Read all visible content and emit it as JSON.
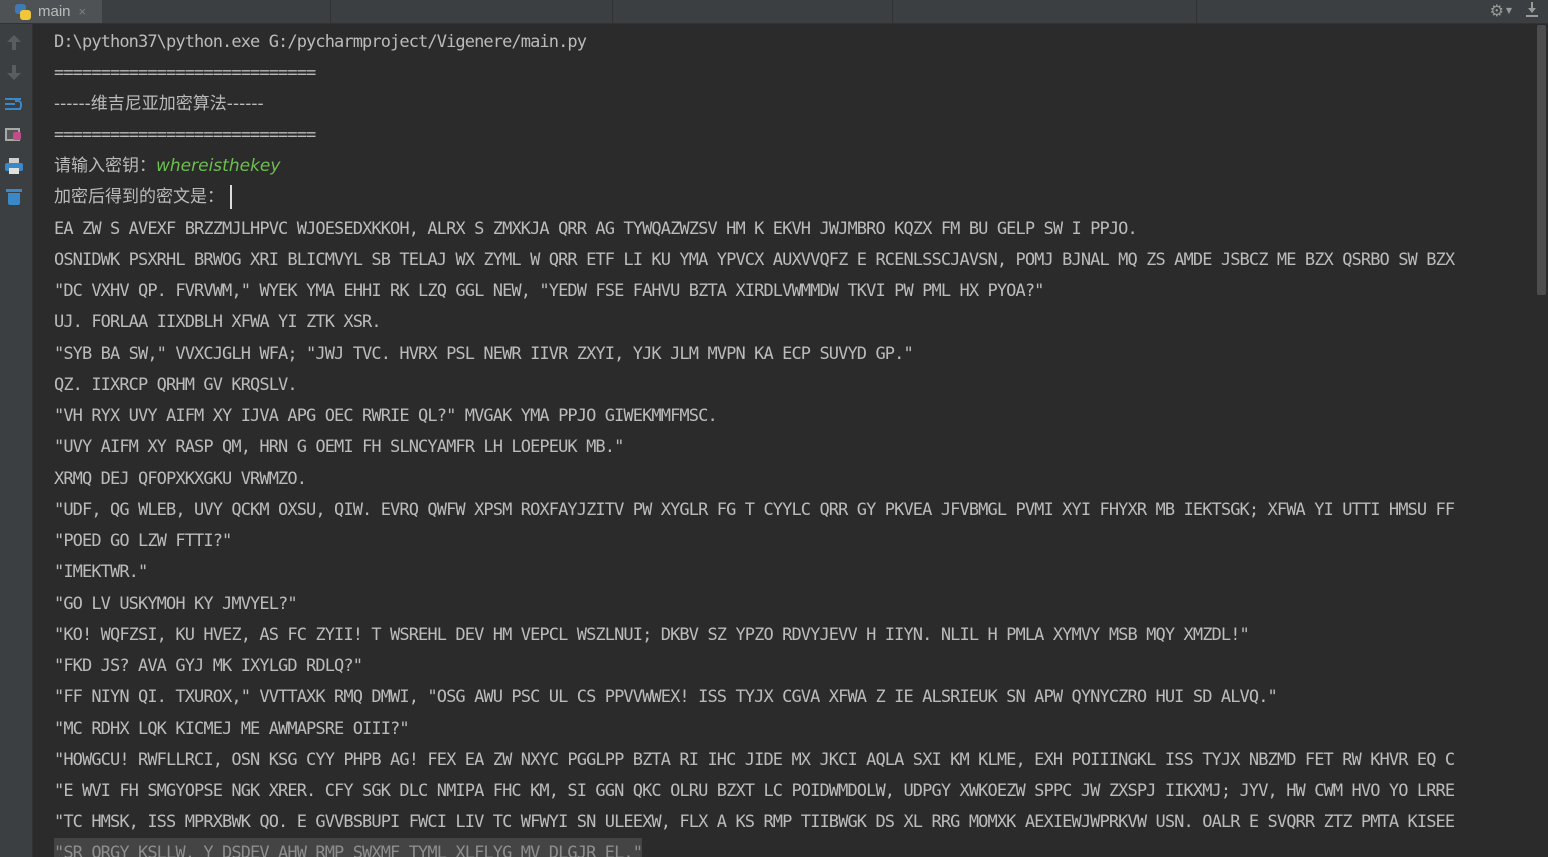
{
  "tabbar": {
    "tab_label": "main",
    "close_glyph": "×"
  },
  "toolstrip": {
    "icons": [
      "arrow-up-icon",
      "arrow-down-icon",
      "soft-wrap-icon",
      "scroll-to-end-icon",
      "print-icon",
      "trash-icon"
    ]
  },
  "console": {
    "lines": [
      "D:\\python37\\python.exe G:/pycharmproject/Vigenere/main.py",
      "============================",
      "------维吉尼亚加密算法------",
      "============================",
      "请输入密钥：",
      "加密后得到的密文是：",
      "EA ZW S AVEXF BRZZMJLHPVC WJOESEDXKKOH, ALRX S ZMXKJA QRR AG TYWQAZWZSV HM K EKVH JWJMBRO KQZX FM BU GELP SW I PPJO.",
      "OSNIDWK PSXRHL BRWOG XRI BLICMVYL SB TELAJ WX ZYML W QRR ETF LI KU YMA YPVCX AUXVVQFZ E RCENLSSCJAVSN, POMJ BJNAL MQ ZS AMDE JSBCZ ME BZX QSRBO SW BZX",
      "\"DC VXHV QP. FVRVWM,\" WYEK YMA EHHI RK LZQ GGL NEW, \"YEDW FSE FAHVU BZTA XIRDLVWMMDW TKVI PW PML HX PYOA?\"",
      "UJ. FORLAA IIXDBLH XFWA YI ZTK XSR.",
      "\"SYB BA SW,\" VVXCJGLH WFA; \"JWJ TVC. HVRX PSL NEWR IIVR ZXYI, YJK JLM MVPN KA ECP SUVYD GP.\"",
      "QZ. IIXRCP QRHM GV KRQSLV.",
      "\"VH RYX UVY AIFM XY IJVA APG OEC RWRIE QL?\" MVGAK YMA PPJO GIWEKMMFMSC.",
      "\"UVY AIFM XY RASP QM, HRN G OEMI FH SLNCYAMFR LH LOEPEUK MB.\"",
      "XRMQ DEJ QFOPXKXGKU VRWMZO.",
      "\"UDF, QG WLEB, UVY QCKM OXSU, QIW. EVRQ QWFW XPSM ROXFAYJZITV PW XYGLR FG T CYYLC QRR GY PKVEA JFVBMGL PVMI XYI FHYXR MB IEKTSGK; XFWA YI UTTI HMSU FF",
      "\"POED GO LZW FTTI?\"",
      "\"IMEKTWR.\"",
      "\"GO LV USKYMOH KY JMVYEL?\"",
      "\"KO! WQFZSI, KU HVEZ, AS FC ZYII! T WSREHL DEV HM VEPCL WSZLNUI; DKBV SZ YPZO RDVYJEVV H IIYN. NLIL H PMLA XYMVY MSB MQY XMZDL!\"",
      "\"FKD JS? AVA GYJ MK IXYLGD RDLQ?\"",
      "\"FF NIYN QI. TXUROX,\" VVTTAXK RMQ DMWI, \"OSG AWU PSC UL CS PPVVWWEX! ISS TYJX CGVA XFWA Z IE ALSRIEUK SN APW QYNYCZRO HUI SD ALVQ.\"",
      "\"MC RDHX LQK KICMEJ ME AWMAPSRE OIII?\"",
      "\"HOWGCU! RWFLLRCI, OSN KSG CYY PHPB AG! FEX EA ZW NXYC PGGLPP BZTA RI IHC JIDE MX JKCI AQLA SXI KM KLME, EXH POIIINGKL ISS TYJX NBZMD FET RW KHVR EQ C",
      "\"E WVI FH SMGYOPSE NGK XRER. CFY SGK DLC NMIPA FHC KM, SI GGN QKC OLRU BZXT LC POIDWMDOLW, UDPGY XWKOEZW SPPC JW ZXSPJ IIKXMJ; JYV, HW CWM HVO YO LRRE",
      "\"TC HMSK, ISS MPRXBWK QO. E GVVBSBUPI FWCI LIV TC WFWYI SN ULEEXW, FLX A KS RMP TIIBWGK DS XL RRG MOMXK AEXIEWJWPRKVW USN. OALR E SVQRR ZTZ PMTA KISEE",
      "\"SR ORGY KSLLW, Y DSDEV AHW RMP SWXMF TYML XLFLYG MV DLGJR EL.\""
    ],
    "key_input": "whereisthekey"
  }
}
